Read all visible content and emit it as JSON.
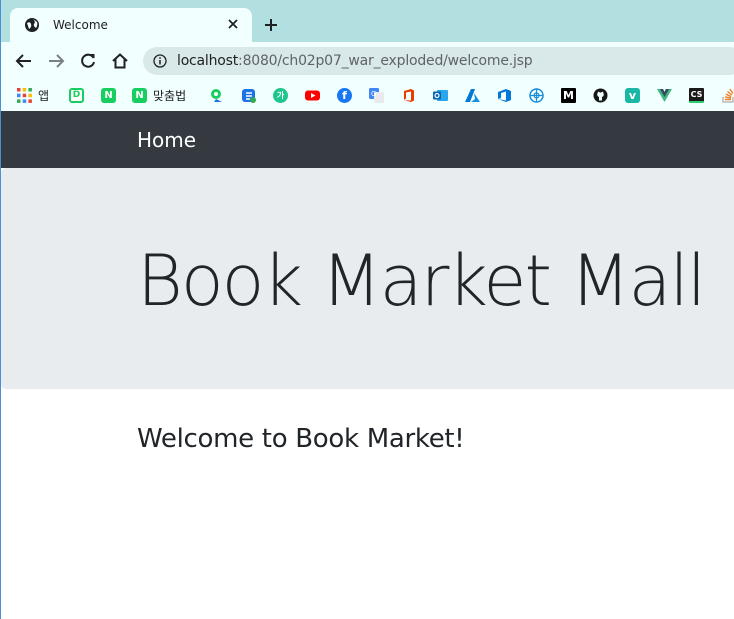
{
  "tab": {
    "title": "Welcome"
  },
  "address": {
    "host": "localhost",
    "path": ":8080/ch02p07_war_exploded/welcome.jsp"
  },
  "bookmarks": {
    "apps_label": "앱",
    "law_label": "맞춤법"
  },
  "navbar": {
    "brand": "Home"
  },
  "jumbotron": {
    "title": "Book Market Mall"
  },
  "content": {
    "welcome": "Welcome to Book Market!"
  },
  "colors": {
    "tabstrip": "#b2dfdf",
    "toolbar": "#f1ffff",
    "navbar": "#343a40",
    "jumbotron": "#e9ecef"
  }
}
